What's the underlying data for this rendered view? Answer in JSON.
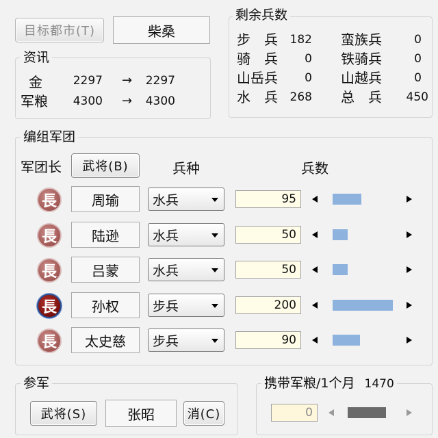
{
  "city": {
    "button_label": "目标都市(T)",
    "value": "柴桑"
  },
  "info": {
    "title": "资讯",
    "gold_label": "金",
    "gold_from": "2297",
    "gold_to": "2297",
    "food_label": "军粮",
    "food_from": "4300",
    "food_to": "4300",
    "arrow": "→"
  },
  "remaining": {
    "title": "剩余兵数",
    "left": [
      {
        "label": "步　兵",
        "value": "182"
      },
      {
        "label": "骑　兵",
        "value": "0"
      },
      {
        "label": "山岳兵",
        "value": "0"
      },
      {
        "label": "水　兵",
        "value": "268"
      }
    ],
    "right": [
      {
        "label": "蛮族兵",
        "value": "0"
      },
      {
        "label": "铁骑兵",
        "value": "0"
      },
      {
        "label": "山越兵",
        "value": "0"
      },
      {
        "label": "总　兵",
        "value": "450"
      }
    ]
  },
  "formation": {
    "title": "编组军团",
    "leader_label": "军团长",
    "general_button": "武将(B)",
    "col_type": "兵种",
    "col_count": "兵数",
    "badge_char": "長",
    "rows": [
      {
        "name": "周瑜",
        "type": "水兵",
        "count": "95",
        "fill": 0.475,
        "active": false
      },
      {
        "name": "陆逊",
        "type": "水兵",
        "count": "50",
        "fill": 0.25,
        "active": false
      },
      {
        "name": "吕蒙",
        "type": "水兵",
        "count": "50",
        "fill": 0.25,
        "active": false
      },
      {
        "name": "孙权",
        "type": "步兵",
        "count": "200",
        "fill": 1.0,
        "active": true
      },
      {
        "name": "太史慈",
        "type": "步兵",
        "count": "90",
        "fill": 0.45,
        "active": false
      }
    ]
  },
  "advisor": {
    "title": "参军",
    "general_button": "武将(S)",
    "name": "张昭",
    "cancel_button": "消(C)"
  },
  "supply": {
    "title": "携带军粮/1个月",
    "per_month": "1470",
    "value": "0",
    "fill": 0.85
  },
  "colors": {
    "bar_fill": "#8db2de",
    "bar_disabled": "#6a6a6a",
    "badge_red": "#a45a57",
    "badge_active": "#7b120f"
  }
}
